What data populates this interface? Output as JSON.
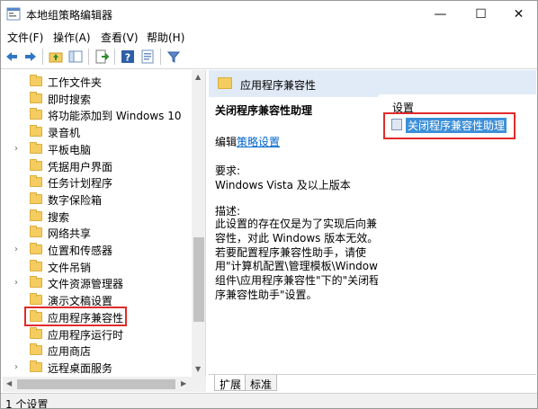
{
  "window": {
    "title": "本地组策略编辑器",
    "min_glyph": "—",
    "max_glyph": "☐",
    "close_glyph": "✕"
  },
  "menu": [
    "文件(F)",
    "操作(A)",
    "查看(V)",
    "帮助(H)"
  ],
  "tree": {
    "items": [
      {
        "label": "工作文件夹",
        "chev": ""
      },
      {
        "label": "即时搜索",
        "chev": ""
      },
      {
        "label": "将功能添加到 Windows 10",
        "chev": ""
      },
      {
        "label": "录音机",
        "chev": ""
      },
      {
        "label": "平板电脑",
        "chev": "›"
      },
      {
        "label": "凭据用户界面",
        "chev": ""
      },
      {
        "label": "任务计划程序",
        "chev": ""
      },
      {
        "label": "数字保险箱",
        "chev": ""
      },
      {
        "label": "搜索",
        "chev": ""
      },
      {
        "label": "网络共享",
        "chev": ""
      },
      {
        "label": "位置和传感器",
        "chev": "›"
      },
      {
        "label": "文件吊销",
        "chev": ""
      },
      {
        "label": "文件资源管理器",
        "chev": "›"
      },
      {
        "label": "演示文稿设置",
        "chev": ""
      },
      {
        "label": "应用程序兼容性",
        "chev": ""
      },
      {
        "label": "应用程序运行时",
        "chev": ""
      },
      {
        "label": "应用商店",
        "chev": ""
      },
      {
        "label": "远程桌面服务",
        "chev": "›"
      }
    ]
  },
  "right": {
    "header": "应用程序兼容性",
    "policy_title": "关闭程序兼容性助理",
    "edit_prefix": "编辑",
    "edit_link": "策略设置",
    "requirements_label": "要求:",
    "requirements_value": "Windows Vista 及以上版本",
    "description_label": "描述:",
    "description_text": "此设置的存在仅是为了实现后向兼容性，对此 Windows 版本无效。若要配置程序兼容性助手，请使用\"计算机配置\\管理模板\\Windows 组件\\应用程序兼容性\"下的\"关闭程序兼容性助手\"设置。",
    "settings_label": "设置",
    "settings_item": "关闭程序兼容性助理",
    "tabs": [
      "扩展",
      "标准"
    ]
  },
  "status": "1 个设置"
}
